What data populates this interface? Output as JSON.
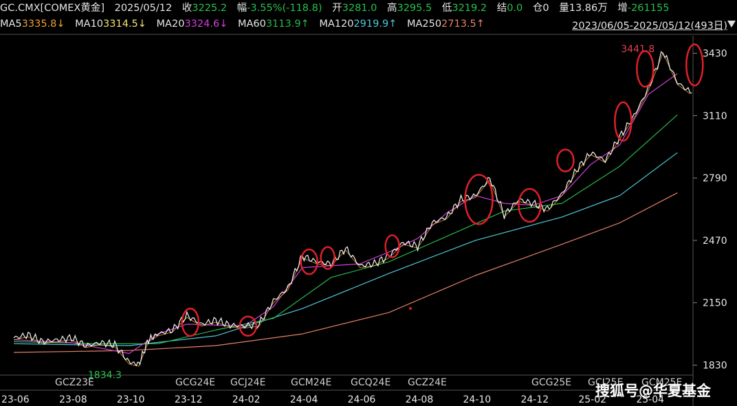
{
  "header": {
    "symbol": "GC.CMX[COMEX黄金]",
    "date": "2025/05/12",
    "close_label": "收",
    "close": "3225.2",
    "change_label": "幅",
    "change": "-3.55%(-118.8)",
    "open_label": "开",
    "open": "3281.0",
    "high_label": "高",
    "high": "3295.5",
    "low_label": "低",
    "low": "3219.2",
    "settle_label": "结",
    "settle": "0.0",
    "oi_label": "仓",
    "oi": "0",
    "volume_label": "量",
    "volume": "13.86万",
    "increase_label": "增",
    "increase": "-261155"
  },
  "ma_legend": [
    {
      "label": "MA5",
      "value": "3335.8↓",
      "color": "#f0a030"
    },
    {
      "label": "MA10",
      "value": "3314.5↓",
      "color": "#f5e66a"
    },
    {
      "label": "MA20",
      "value": "3324.6↓",
      "color": "#d040d8"
    },
    {
      "label": "MA60",
      "value": "3113.9↑",
      "color": "#2bb84a"
    },
    {
      "label": "MA120",
      "value": "2919.9↑",
      "color": "#4fc8d8"
    },
    {
      "label": "MA250",
      "value": "2713.5↑",
      "color": "#e8826a"
    }
  ],
  "date_range": "2023/06/05-2025/05/12(493日)",
  "watermark": "搜狐号@华夏基金",
  "chart_data": {
    "type": "line",
    "y_ticks": [
      1830,
      2150,
      2470,
      2790,
      3110,
      3430
    ],
    "ylim": [
      1800,
      3520
    ],
    "x_ticks": [
      "23-06",
      "23-08",
      "23-10",
      "23-12",
      "24-02",
      "24-04",
      "24-06",
      "24-08",
      "24-10",
      "24-12",
      "25-02",
      "25-04"
    ],
    "contract_labels": [
      "GCZ23E",
      "GCG24E",
      "GCJ24E",
      "GCM24E",
      "GCQ24E",
      "GCZ24E",
      "GCG25E",
      "GCJ25E",
      "GCM25E"
    ],
    "annotations": [
      {
        "text": "3441.8",
        "x": "25-04",
        "y": 3441.8,
        "color": "#e04050"
      },
      {
        "text": "1834.3",
        "x": "23-10",
        "y": 1834.3,
        "color": "#27c24c"
      }
    ],
    "price": [
      [
        "23-06",
        1970
      ],
      [
        "23-06",
        1985
      ],
      [
        "23-07",
        1950
      ],
      [
        "23-07",
        1960
      ],
      [
        "23-08",
        1970
      ],
      [
        "23-08",
        1930
      ],
      [
        "23-09",
        1945
      ],
      [
        "23-09",
        1935
      ],
      [
        "23-10",
        1845
      ],
      [
        "23-10",
        1834.3
      ],
      [
        "23-10",
        1960
      ],
      [
        "23-11",
        1990
      ],
      [
        "23-11",
        2010
      ],
      [
        "23-12",
        2085
      ],
      [
        "23-12",
        2040
      ],
      [
        "24-01",
        2060
      ],
      [
        "24-01",
        2035
      ],
      [
        "24-02",
        2030
      ],
      [
        "24-02",
        2040
      ],
      [
        "24-03",
        2160
      ],
      [
        "24-03",
        2225
      ],
      [
        "24-04",
        2390
      ],
      [
        "24-04",
        2360
      ],
      [
        "24-05",
        2350
      ],
      [
        "24-05",
        2430
      ],
      [
        "24-06",
        2340
      ],
      [
        "24-06",
        2350
      ],
      [
        "24-07",
        2390
      ],
      [
        "24-07",
        2460
      ],
      [
        "24-08",
        2440
      ],
      [
        "24-08",
        2560
      ],
      [
        "24-09",
        2590
      ],
      [
        "24-09",
        2680
      ],
      [
        "24-10",
        2700
      ],
      [
        "24-10",
        2790
      ],
      [
        "24-11",
        2600
      ],
      [
        "24-11",
        2680
      ],
      [
        "24-12",
        2660
      ],
      [
        "24-12",
        2630
      ],
      [
        "25-01",
        2710
      ],
      [
        "25-01",
        2830
      ],
      [
        "25-02",
        2920
      ],
      [
        "25-02",
        2880
      ],
      [
        "25-03",
        3000
      ],
      [
        "25-03",
        3110
      ],
      [
        "25-04",
        3250
      ],
      [
        "25-04",
        3441.8
      ],
      [
        "25-05",
        3280
      ],
      [
        "25-05",
        3225.2
      ]
    ],
    "ma20": [
      [
        "23-06",
        1960
      ],
      [
        "23-08",
        1945
      ],
      [
        "23-10",
        1890
      ],
      [
        "23-11",
        1990
      ],
      [
        "23-12",
        2040
      ],
      [
        "24-02",
        2030
      ],
      [
        "24-03",
        2130
      ],
      [
        "24-04",
        2330
      ],
      [
        "24-06",
        2350
      ],
      [
        "24-07",
        2410
      ],
      [
        "24-08",
        2480
      ],
      [
        "24-09",
        2610
      ],
      [
        "24-10",
        2700
      ],
      [
        "24-11",
        2660
      ],
      [
        "24-12",
        2650
      ],
      [
        "25-01",
        2700
      ],
      [
        "25-02",
        2860
      ],
      [
        "25-03",
        2960
      ],
      [
        "25-04",
        3220
      ],
      [
        "25-05",
        3325
      ]
    ],
    "ma60": [
      [
        "23-06",
        1950
      ],
      [
        "23-09",
        1940
      ],
      [
        "23-11",
        1940
      ],
      [
        "24-01",
        2010
      ],
      [
        "24-03",
        2070
      ],
      [
        "24-05",
        2280
      ],
      [
        "24-07",
        2360
      ],
      [
        "24-09",
        2490
      ],
      [
        "24-11",
        2620
      ],
      [
        "25-01",
        2660
      ],
      [
        "25-03",
        2850
      ],
      [
        "25-05",
        3114
      ]
    ],
    "ma120": [
      [
        "23-06",
        1940
      ],
      [
        "23-10",
        1930
      ],
      [
        "24-01",
        1980
      ],
      [
        "24-04",
        2120
      ],
      [
        "24-07",
        2300
      ],
      [
        "24-10",
        2470
      ],
      [
        "25-01",
        2590
      ],
      [
        "25-03",
        2700
      ],
      [
        "25-05",
        2920
      ]
    ],
    "ma250": [
      [
        "23-06",
        1895
      ],
      [
        "23-10",
        1905
      ],
      [
        "24-01",
        1930
      ],
      [
        "24-04",
        1990
      ],
      [
        "24-07",
        2100
      ],
      [
        "24-10",
        2290
      ],
      [
        "25-01",
        2450
      ],
      [
        "25-03",
        2560
      ],
      [
        "25-05",
        2714
      ]
    ],
    "highlight_circles": [
      {
        "x": "23-12",
        "y": 2050
      },
      {
        "x": "24-02",
        "y": 2030
      },
      {
        "x": "24-04",
        "y": 2360
      },
      {
        "x": "24-05",
        "y": 2380
      },
      {
        "x": "24-07",
        "y": 2440
      },
      {
        "x": "24-10",
        "y": 2680
      },
      {
        "x": "24-12",
        "y": 2650
      },
      {
        "x": "25-01",
        "y": 2880
      },
      {
        "x": "25-03",
        "y": 3080
      },
      {
        "x": "25-04",
        "y": 3350
      },
      {
        "x": "25-05",
        "y": 3370
      }
    ]
  }
}
